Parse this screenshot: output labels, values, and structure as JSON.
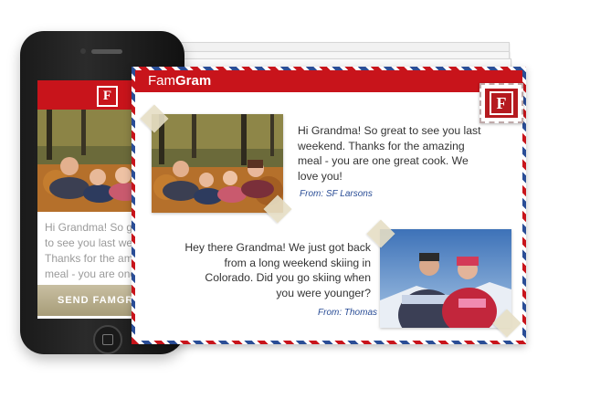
{
  "brand": {
    "name_part1": "Fam",
    "name_part2": "Gram",
    "logo_letter": "F",
    "red": "#c8141b",
    "airmail_blue": "#2a4d96"
  },
  "phone": {
    "message": "Hi Grandma! So great\nto see you last week\nThanks for the amaz\nmeal - you are one\ncook. We love you!",
    "send_label": "SEND FAMGRA",
    "photo_subject": "family lying in autumn leaves"
  },
  "card": {
    "posts": [
      {
        "message": "Hi Grandma! So great to see you last\nweekend. Thanks for the amazing\nmeal - you are one great cook. We\nlove you!",
        "from": "From: SF Larsons",
        "photo_subject": "family lying in autumn leaves"
      },
      {
        "message": "Hey there Grandma! We just got back\nfrom a long weekend skiing in\nColorado. Did you go skiing when\nyou were younger?",
        "from": "From: Thomas",
        "photo_subject": "couple in ski jackets on snowy mountain"
      }
    ]
  }
}
